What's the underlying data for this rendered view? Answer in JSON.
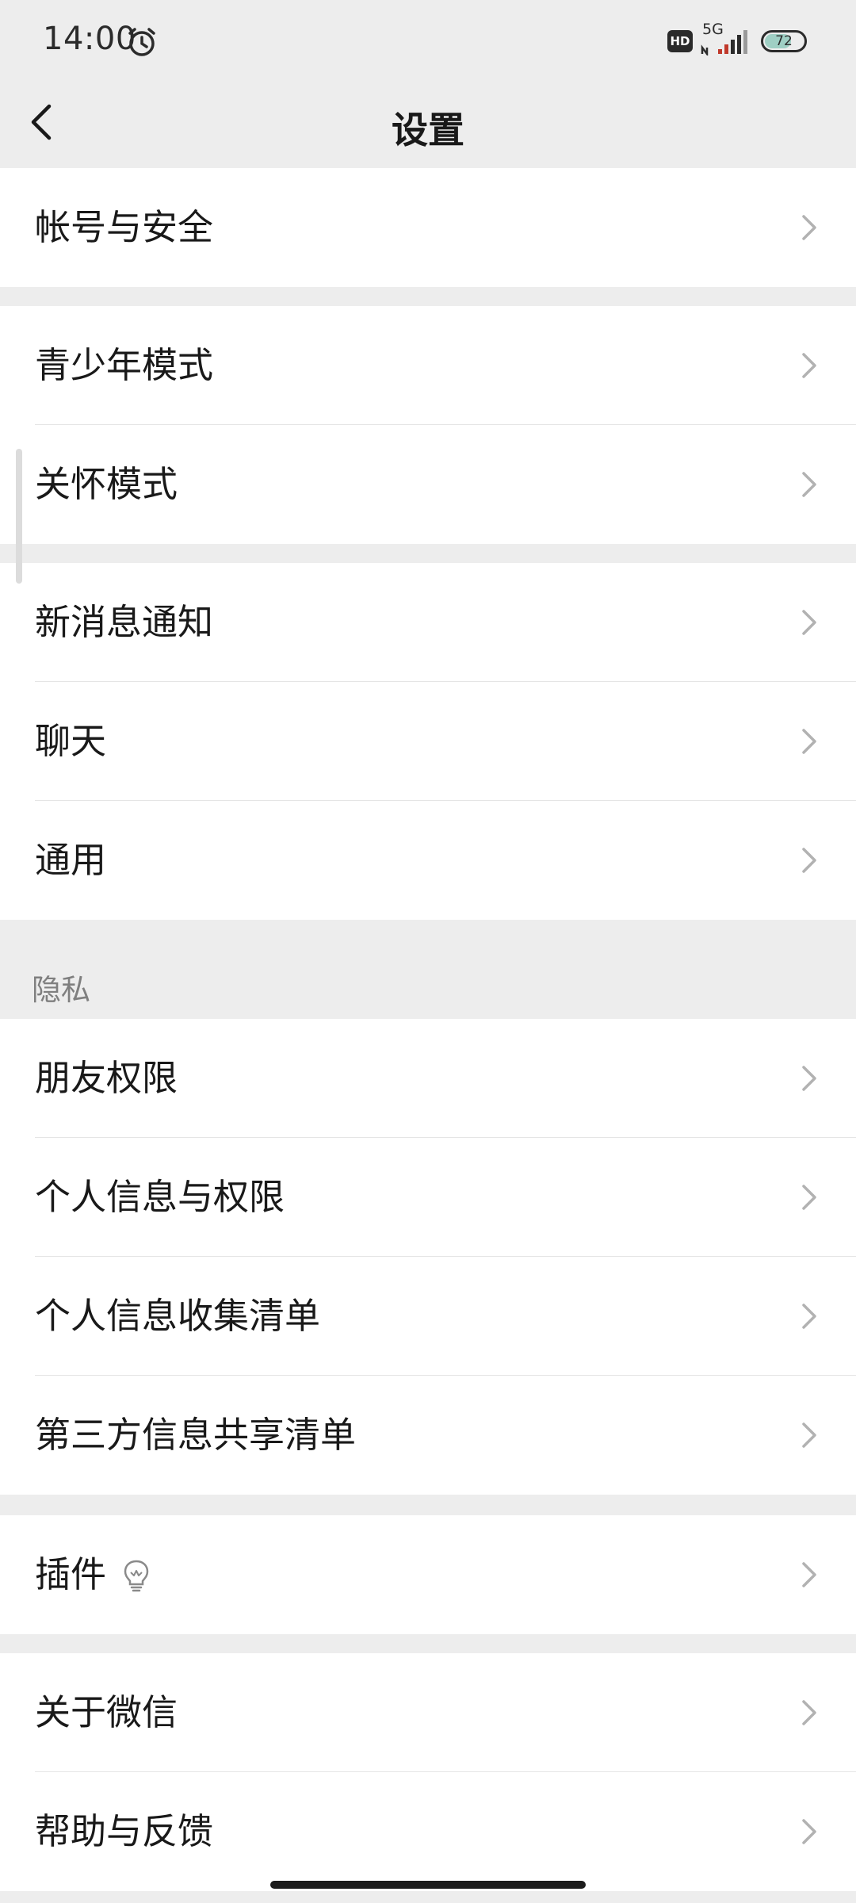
{
  "status_bar": {
    "time": "14:00",
    "hd": "HD",
    "network": "5G",
    "battery": 72
  },
  "header": {
    "title": "设置"
  },
  "groups": {
    "account": [
      "帐号与安全"
    ],
    "modes": [
      "青少年模式",
      "关怀模式"
    ],
    "general": [
      "新消息通知",
      "聊天",
      "通用"
    ],
    "privacy": {
      "header": "隐私",
      "items": [
        "朋友权限",
        "个人信息与权限",
        "个人信息收集清单",
        "第三方信息共享清单"
      ]
    },
    "plugins": [
      "插件"
    ],
    "about": [
      "关于微信",
      "帮助与反馈"
    ]
  },
  "icons": {
    "back": "back-arrow-icon",
    "chevron": "chevron-right-icon",
    "plugin_badge": "lightbulb-icon",
    "alarm": "alarm-clock-icon"
  },
  "colors": {
    "background": "#ededed",
    "row_background": "#ffffff",
    "text": "#191919",
    "secondary_text": "#7f7f7f",
    "chevron": "#b2b2b2",
    "battery_fill": "#9fcfc4"
  }
}
